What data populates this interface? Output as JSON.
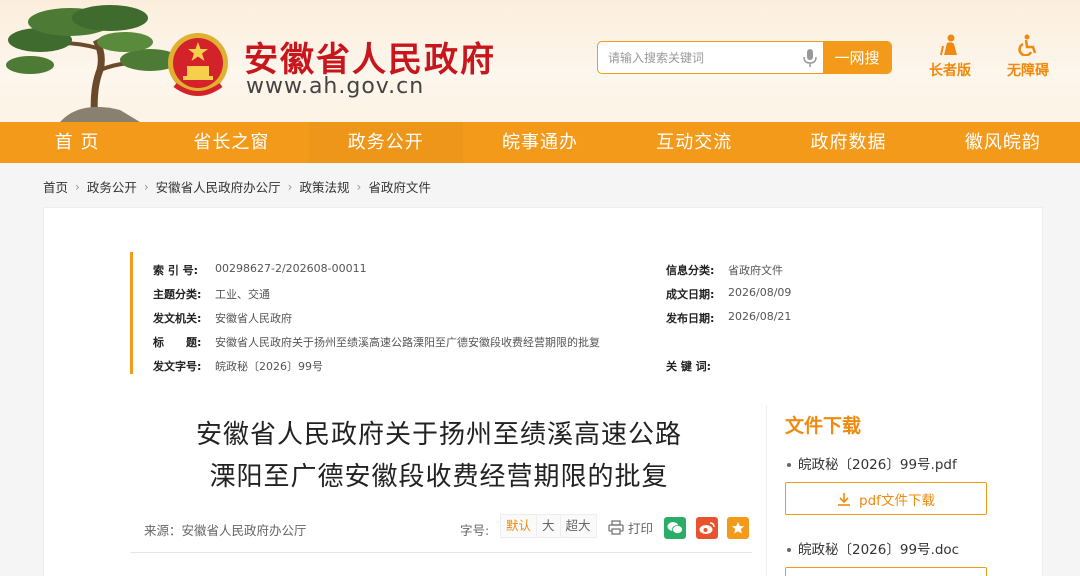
{
  "header": {
    "site_title": "安徽省人民政府",
    "site_url": "www.ah.gov.cn",
    "search_placeholder": "请输入搜索关键词",
    "search_button": "一网搜",
    "tool_elder": "长者版",
    "tool_access": "无障碍"
  },
  "nav": {
    "items": [
      "首 页",
      "省长之窗",
      "政务公开",
      "皖事通办",
      "互动交流",
      "政府数据",
      "徽风皖韵"
    ]
  },
  "breadcrumb": [
    "首页",
    "政务公开",
    "安徽省人民政府办公厅",
    "政策法规",
    "省政府文件"
  ],
  "meta": {
    "index_label": "索 引 号:",
    "index_value": "00298627-2/202608-00011",
    "category_label": "信息分类:",
    "category_value": "省政府文件",
    "topic_label": "主题分类:",
    "topic_value": "工业、交通",
    "formed_label": "成文日期:",
    "formed_value": "2026/08/09",
    "issuer_label": "发文机关:",
    "issuer_value": "安徽省人民政府",
    "published_label": "发布日期:",
    "published_value": "2026/08/21",
    "title_label": "标　　题:",
    "title_value": "安徽省人民政府关于扬州至绩溪高速公路溧阳至广德安徽段收费经营期限的批复",
    "docno_label": "发文字号:",
    "docno_value": "皖政秘〔2026〕99号",
    "keyword_label": "关 键 词:",
    "keyword_value": ""
  },
  "document": {
    "title_line1": "安徽省人民政府关于扬州至绩溪高速公路",
    "title_line2": "溧阳至广德安徽段收费经营期限的批复",
    "source": "来源：安徽省人民政府办公厅",
    "font_size_label": "字号:",
    "font_options": [
      "默认",
      "大",
      "超大"
    ],
    "print_label": "打印"
  },
  "sidebar": {
    "title": "文件下载",
    "files": [
      {
        "name": "皖政秘〔2026〕99号.pdf",
        "button": "pdf文件下载"
      },
      {
        "name": "皖政秘〔2026〕99号.doc",
        "button": ""
      }
    ]
  },
  "colors": {
    "accent": "#f39a1b",
    "brand_red": "#c8161d"
  }
}
